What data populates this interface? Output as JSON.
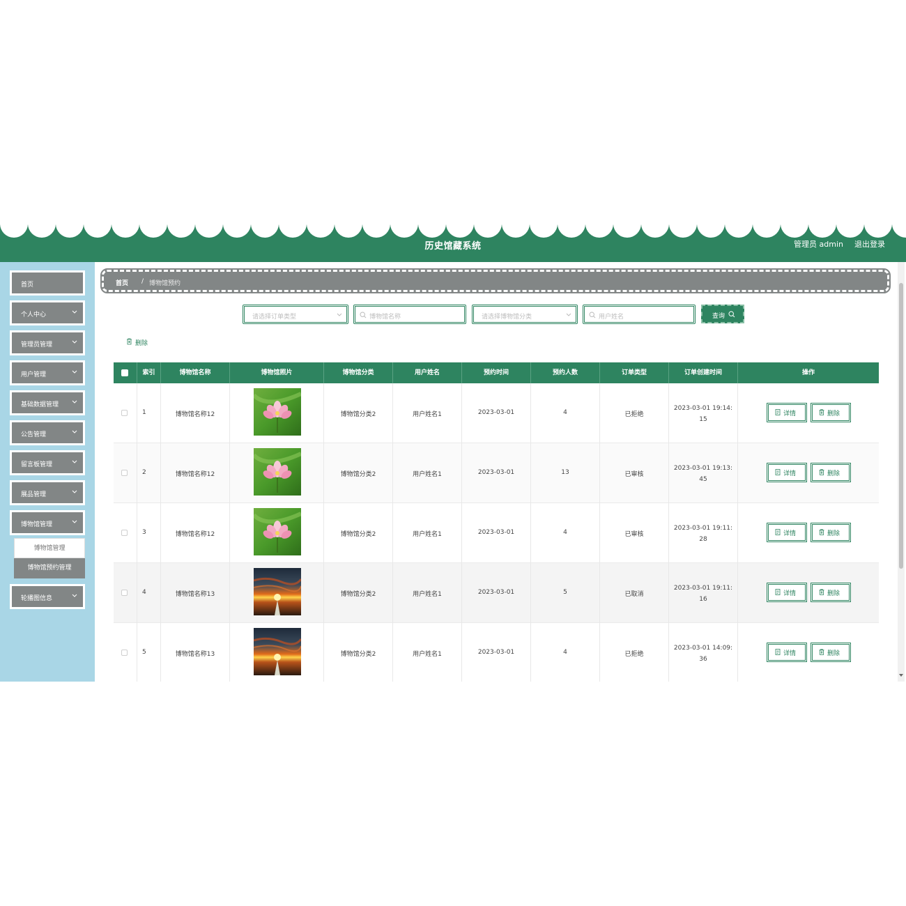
{
  "header": {
    "title": "历史馆藏系统",
    "user": "管理员 admin",
    "logout": "退出登录",
    "color": "#2e8460"
  },
  "sidebar": {
    "items": [
      {
        "label": "首页",
        "icon": "",
        "has_chevron": false
      },
      {
        "label": "个人中心",
        "icon": "chevron-down-icon",
        "has_chevron": true
      },
      {
        "label": "管理员管理",
        "icon": "chevron-down-icon",
        "has_chevron": true
      },
      {
        "label": "用户管理",
        "icon": "chevron-down-icon",
        "has_chevron": true
      },
      {
        "label": "基础数据管理",
        "icon": "chevron-down-icon",
        "has_chevron": true
      },
      {
        "label": "公告管理",
        "icon": "chevron-down-icon",
        "has_chevron": true
      },
      {
        "label": "留言板管理",
        "icon": "chevron-down-icon",
        "has_chevron": true
      },
      {
        "label": "展品管理",
        "icon": "chevron-down-icon",
        "has_chevron": true
      },
      {
        "label": "博物馆管理",
        "icon": "chevron-down-icon",
        "has_chevron": true
      },
      {
        "label": "轮播图信息",
        "icon": "chevron-down-icon",
        "has_chevron": true
      }
    ],
    "submenu": [
      "博物馆管理",
      "博物馆预约管理"
    ]
  },
  "breadcrumb": {
    "home": "首页",
    "sep": "/",
    "current": "博物馆预约"
  },
  "search": {
    "order_type_placeholder": "请选择订单类型",
    "museum_name_placeholder": "博物馆名称",
    "museum_category_placeholder": "请选择博物馆分类",
    "user_name_placeholder": "用户姓名",
    "query_label": "查询"
  },
  "toolbar": {
    "delete_label": "删除"
  },
  "table": {
    "headers": [
      "索引",
      "博物馆名称",
      "博物馆照片",
      "博物馆分类",
      "用户姓名",
      "预约时间",
      "预约人数",
      "订单类型",
      "订单创建时间",
      "操作"
    ],
    "rows": [
      {
        "index": "1",
        "name": "博物馆名称12",
        "photo": "lotus",
        "category": "博物馆分类2",
        "user": "用户姓名1",
        "date": "2023-03-01",
        "count": "4",
        "status": "已拒绝",
        "created_1": "2023-03-01 19:14:",
        "created_2": "15"
      },
      {
        "index": "2",
        "name": "博物馆名称12",
        "photo": "lotus",
        "category": "博物馆分类2",
        "user": "用户姓名1",
        "date": "2023-03-01",
        "count": "13",
        "status": "已审核",
        "created_1": "2023-03-01 19:13:",
        "created_2": "45"
      },
      {
        "index": "3",
        "name": "博物馆名称12",
        "photo": "lotus",
        "category": "博物馆分类2",
        "user": "用户姓名1",
        "date": "2023-03-01",
        "count": "4",
        "status": "已审核",
        "created_1": "2023-03-01 19:11:",
        "created_2": "28"
      },
      {
        "index": "4",
        "name": "博物馆名称13",
        "photo": "sunset",
        "category": "博物馆分类2",
        "user": "用户姓名1",
        "date": "2023-03-01",
        "count": "5",
        "status": "已取消",
        "created_1": "2023-03-01 19:11:",
        "created_2": "16"
      },
      {
        "index": "5",
        "name": "博物馆名称13",
        "photo": "sunset",
        "category": "博物馆分类2",
        "user": "用户姓名1",
        "date": "2023-03-01",
        "count": "4",
        "status": "已拒绝",
        "created_1": "2023-03-01 14:09:",
        "created_2": "36"
      }
    ],
    "actions": {
      "detail": "详情",
      "delete": "删除"
    }
  }
}
